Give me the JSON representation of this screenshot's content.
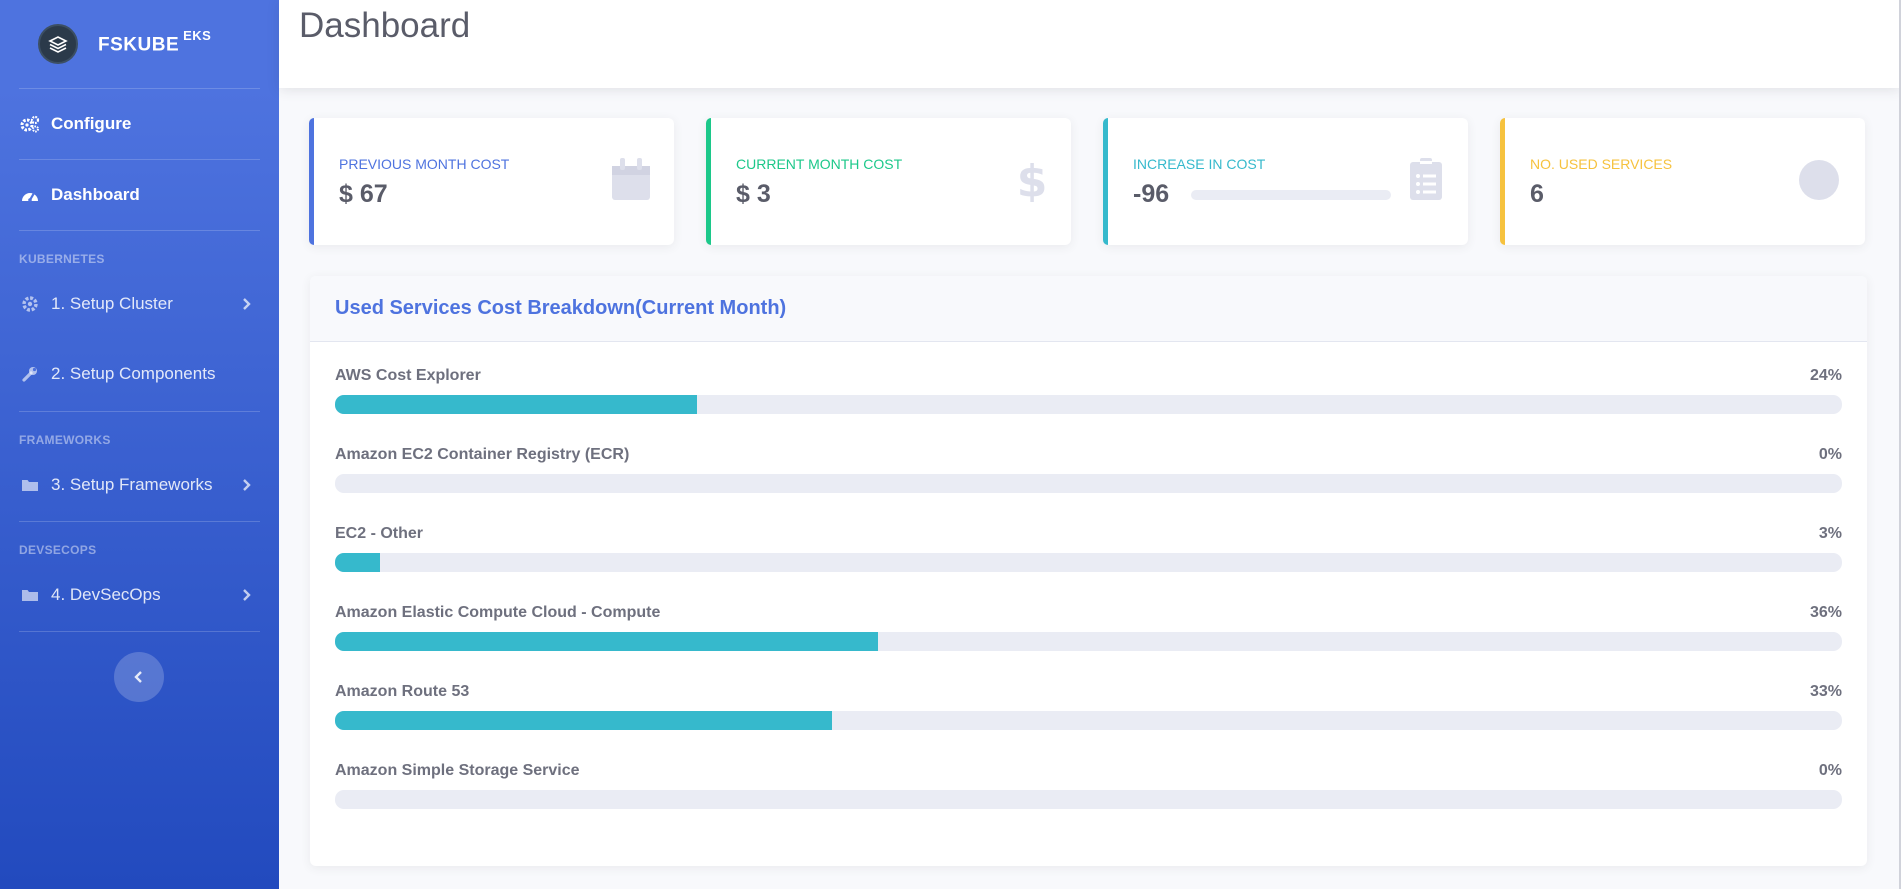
{
  "brand": {
    "name": "FSKUBE",
    "suffix": "EKS"
  },
  "sidebar": {
    "configure": "Configure",
    "dashboard": "Dashboard",
    "sections": {
      "kubernetes": "KUBERNETES",
      "frameworks": "FRAMEWORKS",
      "devsecops": "DEVSECOPS"
    },
    "items": {
      "setup_cluster": "1. Setup Cluster",
      "setup_components": "2. Setup Components",
      "setup_frameworks": "3. Setup Frameworks",
      "devsecops": "4. DevSecOps"
    }
  },
  "header": {
    "title": "Dashboard"
  },
  "cards": [
    {
      "label": "PREVIOUS MONTH COST",
      "value": "$ 67",
      "color": "#4e73df",
      "icon": "calendar-icon"
    },
    {
      "label": "CURRENT MONTH COST",
      "value": "$ 3",
      "color": "#1cc88a",
      "icon": "dollar-icon"
    },
    {
      "label": "INCREASE IN COST",
      "value": "-96",
      "color": "#36b9cc",
      "icon": "clipboard-list-icon",
      "progress": 0
    },
    {
      "label": "NO. USED SERVICES",
      "value": "6",
      "color": "#f6c23e",
      "icon": "circle-icon"
    }
  ],
  "breakdown": {
    "title": "Used Services Cost Breakdown(Current Month)",
    "services": [
      {
        "name": "AWS Cost Explorer",
        "pct_label": "24%",
        "pct": 24
      },
      {
        "name": "Amazon EC2 Container Registry (ECR)",
        "pct_label": "0%",
        "pct": 0
      },
      {
        "name": "EC2 - Other",
        "pct_label": "3%",
        "pct": 3
      },
      {
        "name": "Amazon Elastic Compute Cloud - Compute",
        "pct_label": "36%",
        "pct": 36
      },
      {
        "name": "Amazon Route 53",
        "pct_label": "33%",
        "pct": 33
      },
      {
        "name": "Amazon Simple Storage Service",
        "pct_label": "0%",
        "pct": 0
      }
    ]
  },
  "colors": {
    "primary": "#4e73df",
    "success": "#1cc88a",
    "info": "#36b9cc",
    "warning": "#f6c23e"
  }
}
